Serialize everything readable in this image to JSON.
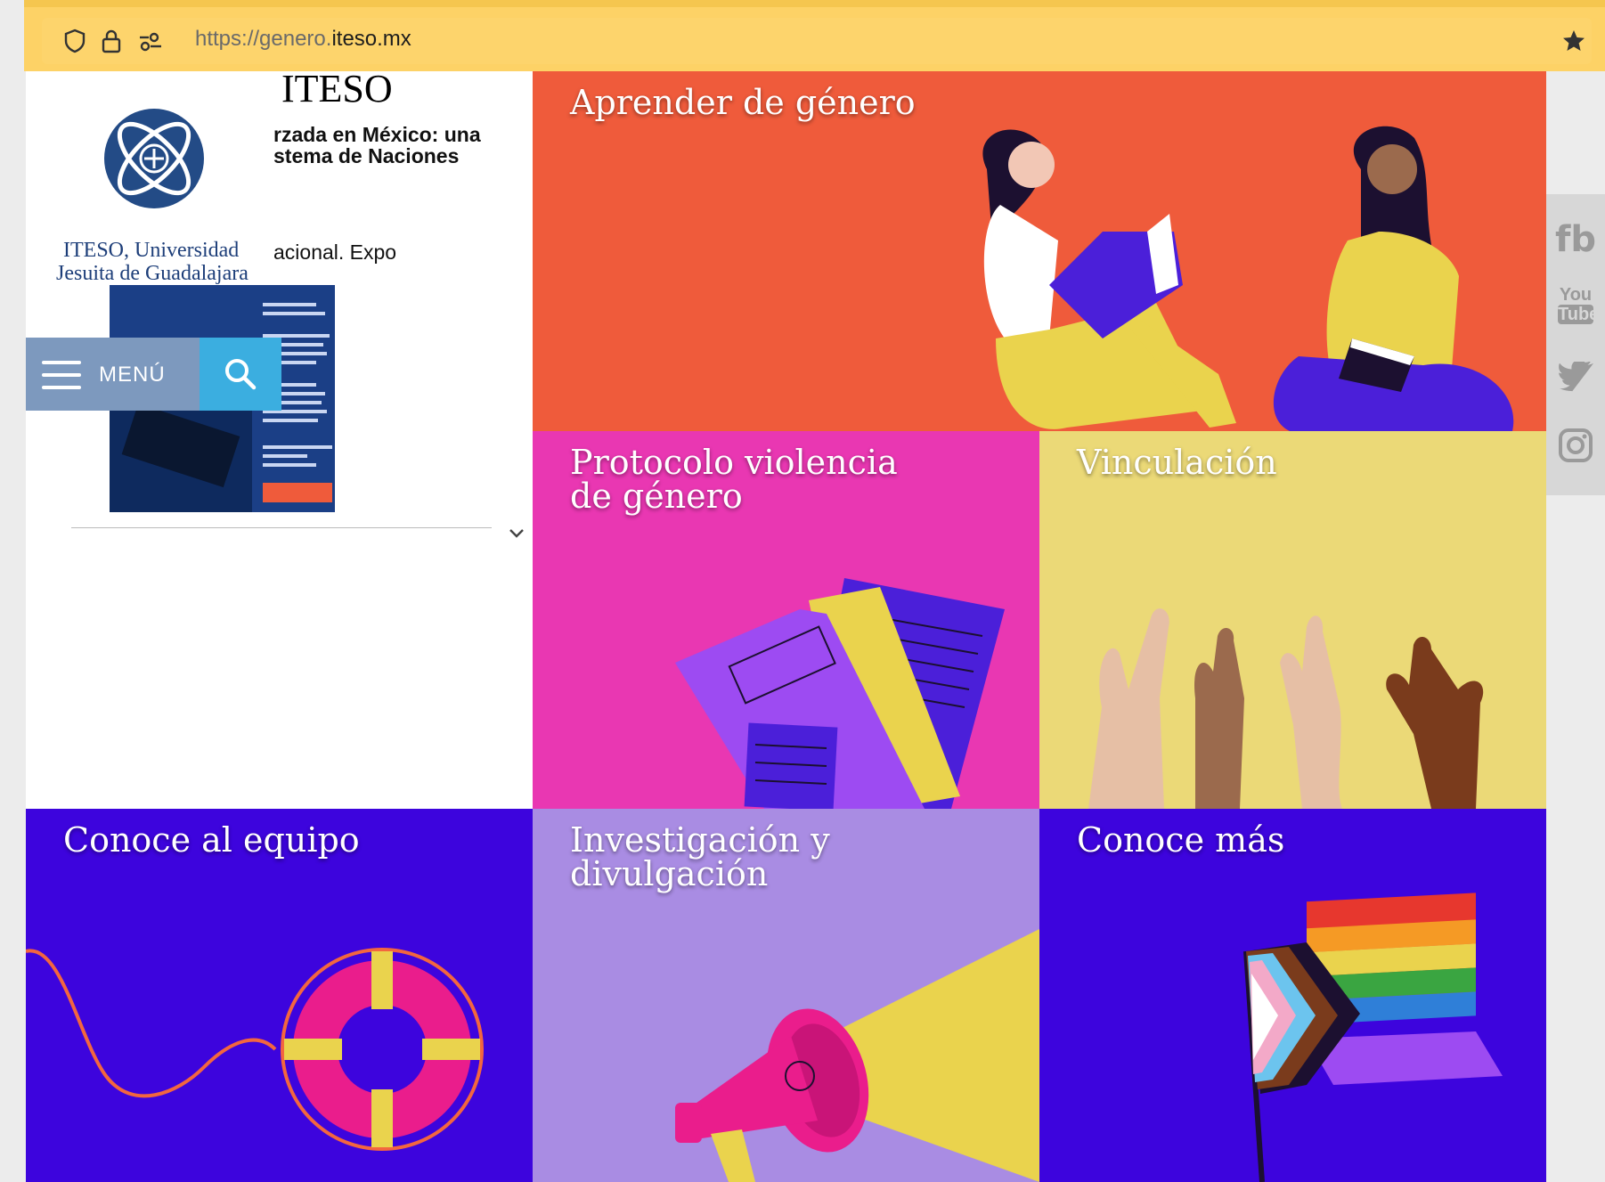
{
  "browser": {
    "url_prefix": "https://genero.",
    "url_domain": "iteso.mx"
  },
  "sidebar": {
    "logo_line1": "ITESO, Universidad",
    "logo_line2": "Jesuita de Guadalajara",
    "menu_label": "MENÚ"
  },
  "news": {
    "title": "ITESO",
    "line1": "rzada en México: una",
    "line2": "stema de Naciones",
    "line3": "acional. Expo"
  },
  "tiles": [
    {
      "title": "Aprender de género",
      "color": "#ef5b3b"
    },
    {
      "title": "Protocolo violencia de género",
      "color": "#e937b2"
    },
    {
      "title": "Vinculación",
      "color": "#ebd977"
    },
    {
      "title": "Conoce al equipo",
      "color": "#3d04dd"
    },
    {
      "title": "Investigación y divulgación",
      "color": "#a98ce3"
    },
    {
      "title": "Conoce más",
      "color": "#3d04dd"
    }
  ],
  "tile_titles": {
    "aprender": "Aprender de género",
    "protocolo_1": "Protocolo violencia",
    "protocolo_2": "de género",
    "vinculacion": "Vinculación",
    "equipo": "Conoce al equipo",
    "investigacion_1": "Investigación y",
    "investigacion_2": "divulgación",
    "conoce_mas": "Conoce más"
  },
  "social": {
    "facebook": "fb",
    "youtube_1": "You",
    "youtube_2": "Tube"
  }
}
